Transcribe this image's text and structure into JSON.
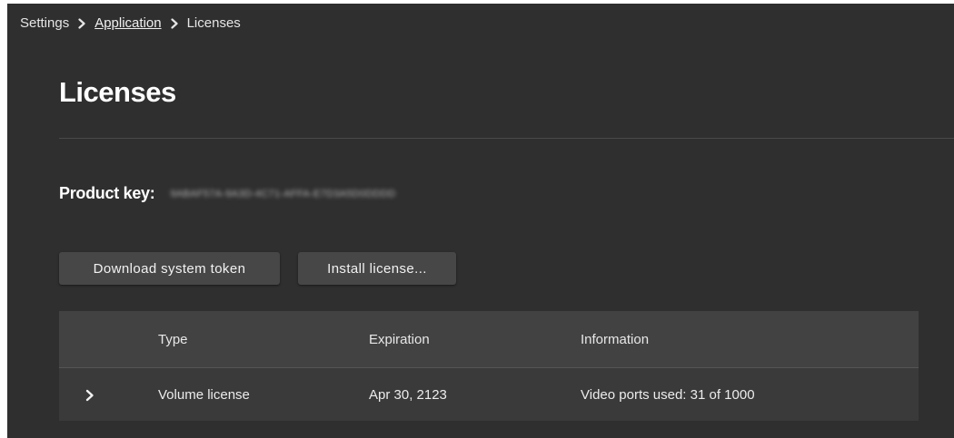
{
  "breadcrumb": {
    "items": [
      "Settings",
      "Application",
      "Licenses"
    ]
  },
  "page": {
    "title": "Licenses"
  },
  "product_key": {
    "label": "Product key:",
    "value": "9ABAF57A-9A3D-4C71-AFFA-E7D3A5D0DDDD"
  },
  "actions": {
    "download_label": "Download system token",
    "install_label": "Install license..."
  },
  "table": {
    "columns": [
      "Type",
      "Expiration",
      "Information"
    ],
    "rows": [
      {
        "type": "Volume license",
        "expiration": "Apr 30, 2123",
        "information": "Video ports used: 31 of 1000"
      }
    ]
  },
  "icons": {
    "breadcrumb_separator": "chevron-right-icon",
    "row_expand": "chevron-right-icon"
  },
  "colors": {
    "background": "#2f2f2f",
    "button": "#474747",
    "table_header": "#424242",
    "table_row": "#3a3a3a",
    "text": "#e8e8e8"
  }
}
